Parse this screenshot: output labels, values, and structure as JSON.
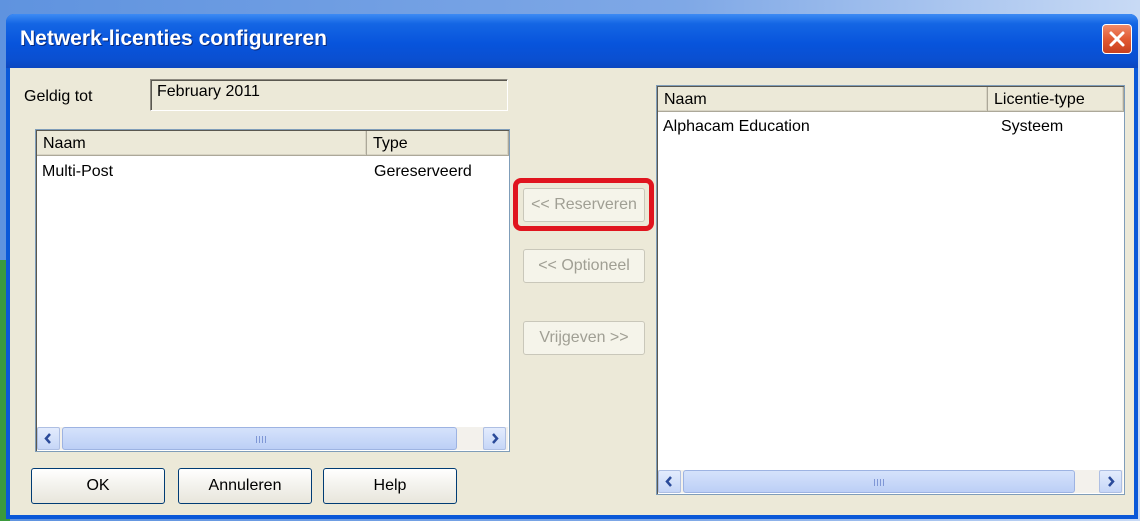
{
  "window": {
    "title": "Netwerk-licenties configureren"
  },
  "valid_until": {
    "label": "Geldig tot",
    "value": "February 2011"
  },
  "left_list": {
    "columns": [
      "Naam",
      "Type"
    ],
    "rows": [
      {
        "name": "Multi-Post",
        "type": "Gereserveerd"
      }
    ]
  },
  "right_list": {
    "columns": [
      "Naam",
      "Licentie-type"
    ],
    "rows": [
      {
        "name": "Alphacam Education",
        "type": "Systeem"
      }
    ]
  },
  "middle_buttons": {
    "reserve": "<< Reserveren",
    "optional": "<< Optioneel",
    "release": "Vrijgeven >>"
  },
  "bottom_buttons": {
    "ok": "OK",
    "cancel": "Annuleren",
    "help": "Help"
  },
  "colors": {
    "title_blue": "#0a58d8",
    "dialog_face": "#ece9d8",
    "highlight_red": "#e0141e"
  },
  "icons": [
    "close-icon",
    "scroll-left-icon",
    "scroll-right-icon"
  ]
}
